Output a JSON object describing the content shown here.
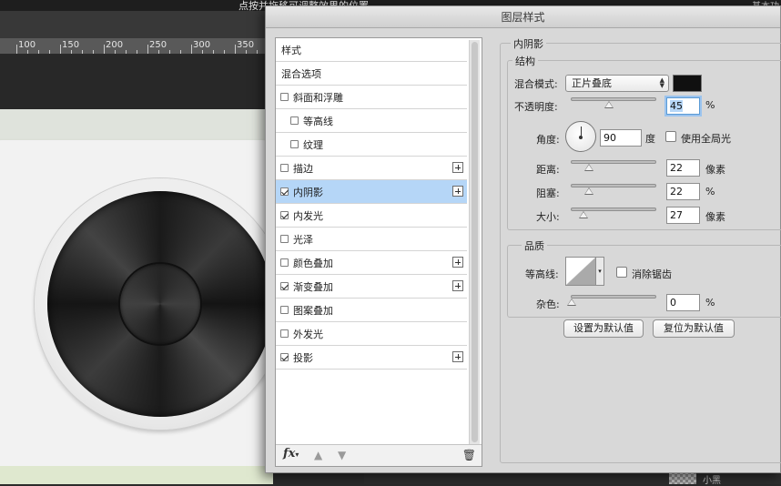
{
  "background": {
    "top_hint": "点按并拖移可调整效果的位置。",
    "top_right_text": "基本功",
    "ruler_labels": [
      "100",
      "150",
      "200",
      "250",
      "300",
      "350"
    ],
    "layer_label": "小黑"
  },
  "dialog": {
    "title": "图层样式",
    "list": {
      "items": [
        {
          "label": "样式"
        },
        {
          "label": "混合选项"
        },
        {
          "label": "斜面和浮雕"
        },
        {
          "label": "等高线"
        },
        {
          "label": "纹理"
        },
        {
          "label": "描边"
        },
        {
          "label": "内阴影"
        },
        {
          "label": "内发光"
        },
        {
          "label": "光泽"
        },
        {
          "label": "颜色叠加"
        },
        {
          "label": "渐变叠加"
        },
        {
          "label": "图案叠加"
        },
        {
          "label": "外发光"
        },
        {
          "label": "投影"
        }
      ],
      "footer": {
        "fx_label": "fx"
      }
    },
    "panel": {
      "title": "内阴影",
      "structure": {
        "title": "结构",
        "blend_mode_label": "混合模式:",
        "blend_mode_value": "正片叠底",
        "swatch_color": "#101010",
        "opacity_label": "不透明度:",
        "opacity_value": "45",
        "opacity_unit": "%",
        "angle_label": "角度:",
        "angle_value": "90",
        "angle_unit": "度",
        "global_light_label": "使用全局光",
        "distance_label": "距离:",
        "distance_value": "22",
        "distance_unit": "像素",
        "choke_label": "阻塞:",
        "choke_value": "22",
        "choke_unit": "%",
        "size_label": "大小:",
        "size_value": "27",
        "size_unit": "像素"
      },
      "quality": {
        "title": "品质",
        "contour_label": "等高线:",
        "antialias_label": "消除锯齿",
        "noise_label": "杂色:",
        "noise_value": "0",
        "noise_unit": "%"
      },
      "buttons": {
        "set_default": "设置为默认值",
        "reset_default": "复位为默认值"
      }
    }
  },
  "colors": {
    "selection": "#b5d6f7",
    "dialog_bg": "#d8d8d8"
  }
}
